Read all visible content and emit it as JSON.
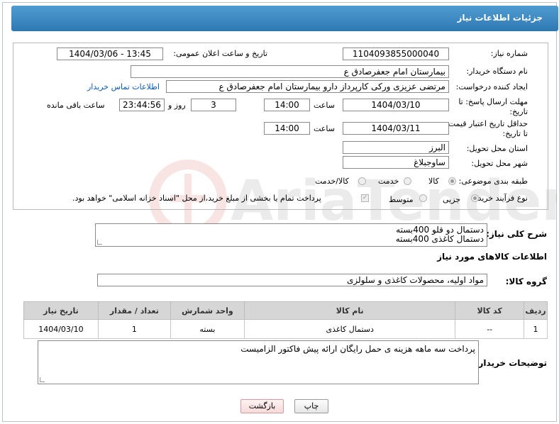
{
  "header": {
    "title": "جزئیات اطلاعات نیاز"
  },
  "form": {
    "need_number": {
      "label": "شماره نیاز:",
      "value": "1104093855000040"
    },
    "announce_datetime": {
      "label": "تاریخ و ساعت اعلان عمومی:",
      "value": "1404/03/06 - 13:45"
    },
    "buyer_org": {
      "label": "نام دستگاه خریدار:",
      "value": "بیمارستان امام جعفرصادق ع"
    },
    "requester": {
      "label": "ایجاد کننده درخواست:",
      "value": "مرتضی عزیزی ورکی کارپرداز دارو بیمارستان امام جعفرصادق ع",
      "contact_link": "اطلاعات تماس خریدار"
    },
    "reply_deadline": {
      "label_line1": "مهلت ارسال پاسخ: تا",
      "label_line2": "تاریخ:",
      "date": "1404/03/10",
      "time_label": "ساعت",
      "time": "14:00",
      "days": "3",
      "days_label": "روز و",
      "remaining": "23:44:56",
      "remaining_label": "ساعت باقی مانده"
    },
    "price_validity": {
      "label_line1": "حداقل تاریخ اعتبار قیمت:",
      "label_line2": "تا تاریخ:",
      "date": "1404/03/11",
      "time_label": "ساعت",
      "time": "14:00"
    },
    "province": {
      "label": "استان محل تحویل:",
      "value": "البرز"
    },
    "city": {
      "label": "شهر محل تحویل:",
      "value": "ساوجبلاغ"
    },
    "category": {
      "label": "طبقه بندی موضوعی:",
      "options": [
        "کالا",
        "خدمت",
        "کالا/خدمت"
      ],
      "selected": "کالا"
    },
    "purchase_process": {
      "label": "نوع فرآیند خرید :",
      "options": [
        "جزیی",
        "متوسط"
      ],
      "selected": "جزیی",
      "treasury_note": "پرداخت تمام یا بخشی از مبلغ خرید،از محل \"اسناد خزانه اسلامی\" خواهد بود."
    }
  },
  "description": {
    "label": "شرح کلی نیاز:",
    "line1": "دستمال دو قلو 400بسته",
    "line2": "دستمال کاغذی 400بسته"
  },
  "goods_info_title": "اطلاعات کالاهای مورد نیاز",
  "goods_group": {
    "label": "گروه کالا:",
    "value": "مواد اولیه، محصولات کاغذی و سلولزی"
  },
  "table": {
    "headers": [
      "ردیف",
      "کد کالا",
      "نام کالا",
      "واحد شمارش",
      "تعداد / مقدار",
      "تاریخ نیاز"
    ],
    "rows": [
      [
        "1",
        "--",
        "دستمال کاغذی",
        "بسته",
        "1",
        "1404/03/10"
      ]
    ]
  },
  "buyer_notes": {
    "label": "توضیحات خریدار:",
    "value": "پرداخت سه ماهه هزینه ی حمل رایگان ارائه پیش فاکتور الزامیست"
  },
  "buttons": {
    "print": "چاپ",
    "back": "بازگشت"
  },
  "watermark_text": "AriaTender.net",
  "colors": {
    "header_bg": "#3a86c0",
    "link": "#0a58b8",
    "back_button": "#f7d9d9"
  }
}
